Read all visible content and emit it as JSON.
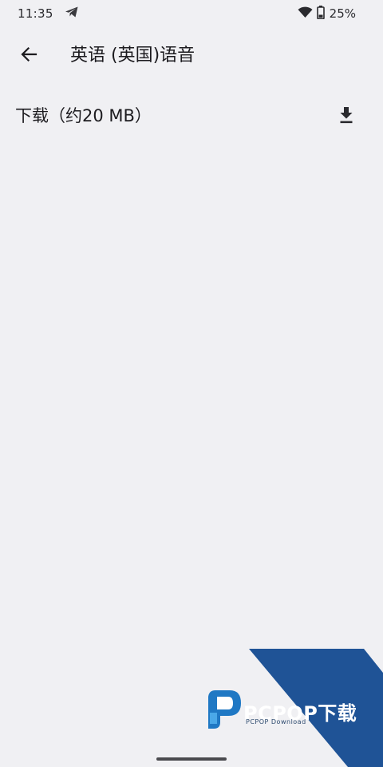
{
  "status_bar": {
    "time": "11:35",
    "battery_percent": "25%",
    "icons": [
      "telegram-icon",
      "wifi-icon",
      "battery-icon"
    ]
  },
  "app_bar": {
    "title": "英语 (英国)语音",
    "back_icon": "arrow-left-icon"
  },
  "download_item": {
    "label": "下载（约20 MB）",
    "icon": "download-icon"
  },
  "watermark": {
    "brand": "PCPOP下载",
    "subtext": "PCPOP Download"
  },
  "colors": {
    "background": "#f0f0f3",
    "text": "#1c1b1f",
    "watermark_blue": "#1f5396"
  }
}
